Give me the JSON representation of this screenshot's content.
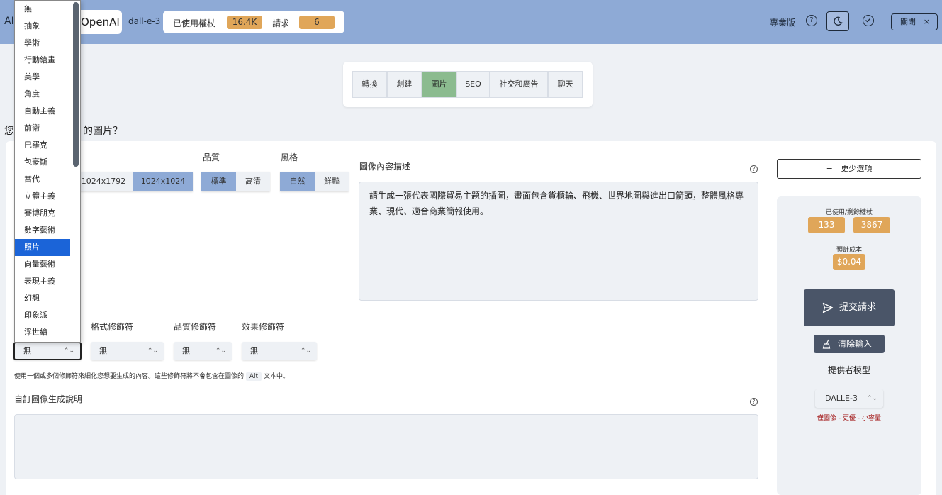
{
  "header": {
    "brand_prefix": "AI",
    "brand": "OpenAI",
    "model": "dall-e-3",
    "tokens_used_label": "已使用權杖",
    "tokens_used_value": "16.4K",
    "requests_label": "請求",
    "requests_value": "6",
    "pro_label": "專業版",
    "help_glyph": "?",
    "close_label": "關閉",
    "close_glyph": "×"
  },
  "tabs": [
    {
      "label": "轉換",
      "active": false
    },
    {
      "label": "創建",
      "active": false
    },
    {
      "label": "圖片",
      "active": true
    },
    {
      "label": "SEO",
      "active": false
    },
    {
      "label": "社交和廣告",
      "active": false
    },
    {
      "label": "聊天",
      "active": false
    }
  ],
  "page": {
    "question_prefix": "您",
    "question_suffix": "的圖片？"
  },
  "size": {
    "options": [
      "1024x1792",
      "1024x1024"
    ],
    "selected": "1024x1024"
  },
  "quality": {
    "label": "品質",
    "options": [
      "標準",
      "高清"
    ],
    "selected": "標準"
  },
  "style": {
    "label": "風格",
    "options": [
      "自然",
      "鮮豔"
    ],
    "selected": "自然"
  },
  "description": {
    "label": "圖像內容描述",
    "value": "請生成一張代表國際貿易主題的插圖，畫面包含貨櫃輪、飛機、世界地圖與進出口箭頭，整體風格專業、現代、適合商業簡報使用。"
  },
  "modifiers": {
    "format_label": "格式修飾符",
    "quality_label": "品質修飾符",
    "effect_label": "效果修飾符",
    "art_value": "無",
    "format_value": "無",
    "quality_value": "無",
    "effect_value": "無",
    "hint_before": "使用一個或多個修飾符來細化您想要生成的內容。這些修飾符將不會包含在圖像的",
    "hint_alt": "Alt",
    "hint_after": "文本中。"
  },
  "custom": {
    "label": "自訂圖像生成說明",
    "value": ""
  },
  "right_panel": {
    "less_options": "更少選項",
    "less_glyph": "−",
    "used_remaining_label": "已使用/剩餘權杖",
    "used": "133",
    "remaining": "3867",
    "cost_label": "預計成本",
    "cost": "$0.04",
    "submit": "提交請求",
    "clear": "清除輸入",
    "provider_label": "提供者模型",
    "provider_value": "DALLE-3",
    "provider_note": "僅圖像 - 更優 - 小容量"
  },
  "dropdown": {
    "selected": "照片",
    "options": [
      "無",
      "抽象",
      "學術",
      "行動繪畫",
      "美學",
      "角度",
      "自動主義",
      "前衛",
      "巴羅克",
      "包豪斯",
      "當代",
      "立體主義",
      "賽博朋克",
      "數字藝術",
      "照片",
      "向量藝術",
      "表現主義",
      "幻想",
      "印象派",
      "浮世繪"
    ]
  },
  "colors": {
    "header_bg": "#8eaad6",
    "accent_orange": "#e0a659",
    "tab_active": "#8bbb8f",
    "seg_active": "#8eaad6",
    "button_dark": "#4a5568",
    "dropdown_highlight": "#1b64d8",
    "note_red": "#a01010"
  },
  "icons": [
    "help-icon",
    "moon-icon",
    "check-circle-icon",
    "close-icon",
    "minus-icon",
    "send-icon",
    "broom-icon",
    "chevron-updown-icon"
  ]
}
